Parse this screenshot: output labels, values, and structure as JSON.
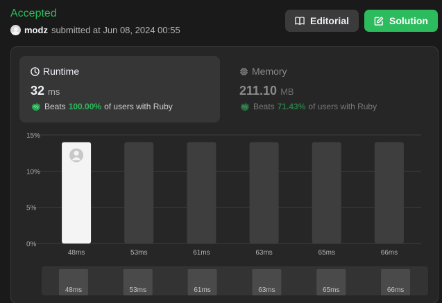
{
  "header": {
    "status": "Accepted",
    "username": "modz",
    "submitted_text": "submitted at Jun 08, 2024 00:55",
    "editorial_label": "Editorial",
    "solution_label": "Solution",
    "accent_color": "#2cbb5d"
  },
  "runtime": {
    "title": "Runtime",
    "value": "32",
    "unit": "ms",
    "beats_label": "Beats",
    "beats_pct": "100.00%",
    "beats_suffix": "of users with Ruby",
    "icon": "clock-icon"
  },
  "memory": {
    "title": "Memory",
    "value": "211.10",
    "unit": "MB",
    "beats_label": "Beats",
    "beats_pct": "71.43%",
    "beats_suffix": "of users with Ruby",
    "icon": "chip-icon"
  },
  "chart_data": {
    "type": "bar",
    "categories": [
      "48ms",
      "53ms",
      "61ms",
      "63ms",
      "65ms",
      "66ms"
    ],
    "values": [
      14,
      14,
      14,
      14,
      14,
      14
    ],
    "highlight_index": 0,
    "yticks": [
      "0%",
      "5%",
      "10%",
      "15%"
    ],
    "ytick_values": [
      0,
      5,
      10,
      15
    ],
    "ylim": [
      0,
      15
    ],
    "grid": true,
    "title": "",
    "xlabel": "",
    "ylabel": ""
  },
  "scroller": {
    "labels": [
      "48ms",
      "53ms",
      "61ms",
      "63ms",
      "65ms",
      "66ms"
    ]
  }
}
